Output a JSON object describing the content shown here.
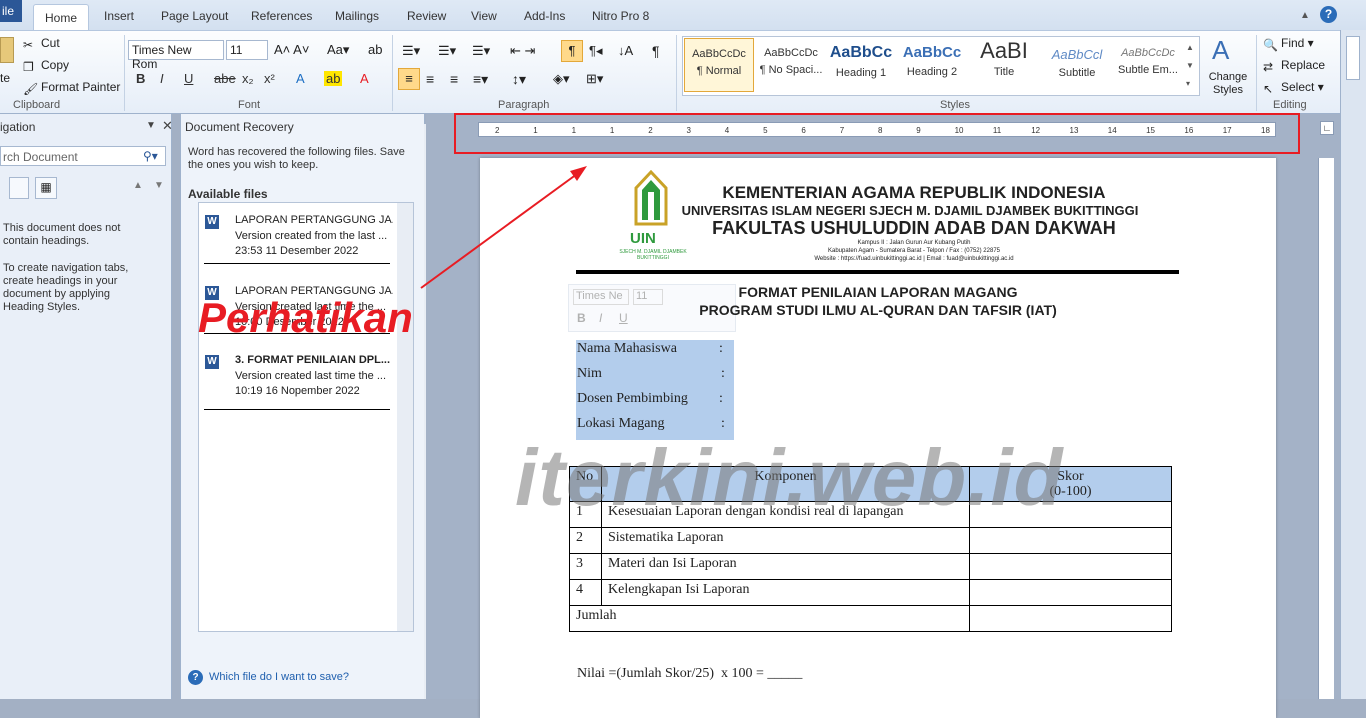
{
  "ribbon": {
    "tabs": [
      "ile",
      "Home",
      "Insert",
      "Page Layout",
      "References",
      "Mailings",
      "Review",
      "View",
      "Add-Ins",
      "Nitro Pro 8"
    ],
    "clipboard": {
      "paste_partial": "te",
      "cut": "Cut",
      "copy": "Copy",
      "format_painter": "Format Painter",
      "label": "Clipboard"
    },
    "font": {
      "family": "Times New Rom",
      "size": "11",
      "label": "Font",
      "bold": "B",
      "italic": "I",
      "underline": "U",
      "strike": "abe",
      "sub": "x₂",
      "sup": "x²"
    },
    "paragraph": {
      "label": "Paragraph",
      "pilcrow": "¶"
    },
    "styles": {
      "label": "Styles",
      "items": [
        {
          "sample": "AaBbCcDc",
          "name": "¶ Normal"
        },
        {
          "sample": "AaBbCcDc",
          "name": "¶ No Spaci..."
        },
        {
          "sample": "AaBbCc",
          "name": "Heading 1"
        },
        {
          "sample": "AaBbCc",
          "name": "Heading 2"
        },
        {
          "sample": "AaBI",
          "name": "Title"
        },
        {
          "sample": "AaBbCcl",
          "name": "Subtitle"
        },
        {
          "sample": "AaBbCcDc",
          "name": "Subtle Em..."
        }
      ],
      "change_styles": "Change Styles"
    },
    "editing": {
      "label": "Editing",
      "find": "Find",
      "replace": "Replace",
      "select": "Select"
    }
  },
  "navigation": {
    "title": "igation",
    "search_placeholder": "rch Document",
    "message1": "This document does not contain headings.",
    "message2": "To create navigation tabs, create headings in your document by applying Heading Styles."
  },
  "recovery": {
    "title": "Document Recovery",
    "intro": "Word has recovered the following files.  Save the ones you wish to keep.",
    "available_label": "Available files",
    "files": [
      {
        "name": "LAPORAN PERTANGGUNG JA...",
        "desc": "Version created from the last ...",
        "time": "23:53 11 Desember 2022"
      },
      {
        "name": "LAPORAN PERTANGGUNG JA...",
        "desc": "Version created last time the ...",
        "time": "10:00 Desember 2022"
      },
      {
        "name": "3. FORMAT PENILAIAN DPL...",
        "desc": "Version created last time the ...",
        "time": "10:19 16 Nopember 2022"
      }
    ],
    "help_link": "Which file do I want to save?"
  },
  "annotation": {
    "text": "Perhatikan",
    "color": "#e81c23"
  },
  "watermark": "iterkini.web.id",
  "ruler": {
    "numbers": [
      "2",
      "1",
      "1",
      "1",
      "2",
      "3",
      "4",
      "5",
      "6",
      "7",
      "8",
      "9",
      "10",
      "11",
      "12",
      "13",
      "14",
      "15",
      "16",
      "17",
      "18"
    ]
  },
  "document": {
    "header": {
      "line1": "KEMENTERIAN AGAMA REPUBLIK INDONESIA",
      "line2": "UNIVERSITAS ISLAM NEGERI SJECH M. DJAMIL DJAMBEK BUKITTINGGI",
      "line3": "FAKULTAS USHULUDDIN ADAB DAN DAKWAH",
      "addr1": "Kampus II : Jalan Gurun Aur Kubang Putih",
      "addr2": "Kabupaten Agam - Sumatera Barat - Telpon / Fax : (0752) 22875",
      "addr3": "Website : https://fuad.uinbukittinggi.ac.id | Email : fuad@uinbukittinggi.ac.id",
      "logo_text": "UIN",
      "logo_sub": "SJECH M. DJAMIL DJAMBEK BUKITTINGGI"
    },
    "title1": "FORMAT PENILAIAN LAPORAN MAGANG",
    "title2": "PROGRAM STUDI ILMU AL-QURAN DAN TAFSIR (IAT)",
    "mini_toolbar": {
      "font": "Times Ne",
      "size": "11"
    },
    "fields": [
      {
        "label": "Nama Mahasiswa",
        "colon": ":"
      },
      {
        "label": "Nim",
        "colon": ":"
      },
      {
        "label": "Dosen Pembimbing",
        "colon": ":"
      },
      {
        "label": "Lokasi Magang",
        "colon": ":"
      }
    ],
    "table": {
      "headers": [
        "No",
        "Komponen",
        "Skor",
        "(0-100)"
      ],
      "rows": [
        {
          "no": "1",
          "komponen": "Kesesuaian Laporan dengan kondisi real di lapangan"
        },
        {
          "no": "2",
          "komponen": "Sistematika Laporan"
        },
        {
          "no": "3",
          "komponen": "Materi dan Isi Laporan"
        },
        {
          "no": "4",
          "komponen": "Kelengkapan Isi Laporan"
        }
      ],
      "total": "Jumlah"
    },
    "formula": "Nilai =(Jumlah Skor/25)  x 100 = _____"
  }
}
